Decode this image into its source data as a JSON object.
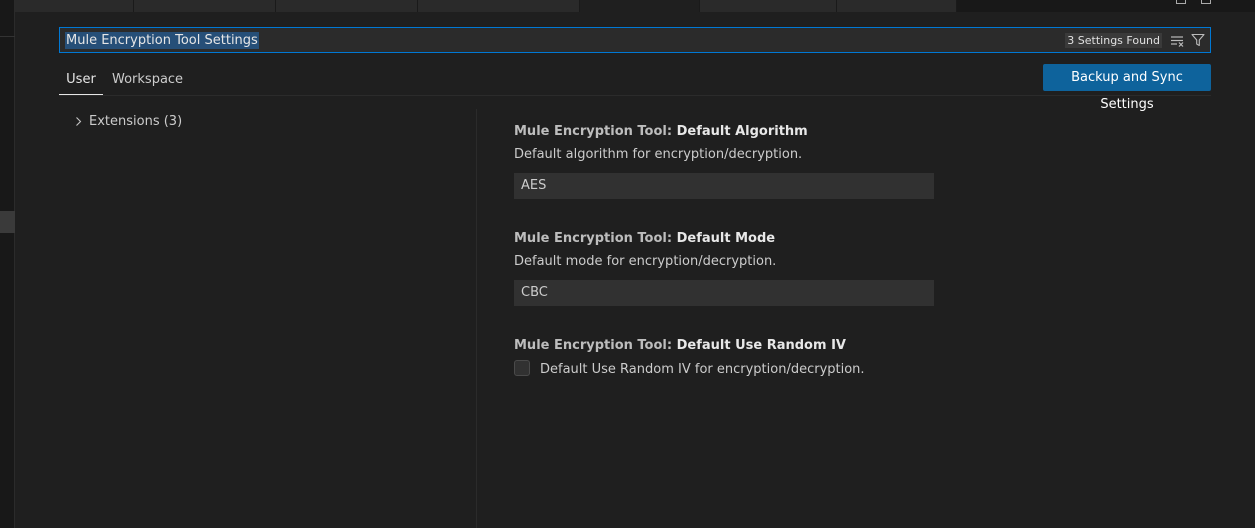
{
  "search": {
    "value": "Mule Encryption Tool Settings",
    "result_count": "3 Settings Found",
    "clear_icon": "clear-filter-icon",
    "filter_icon": "filter-icon"
  },
  "scope_tabs": [
    {
      "label": "User",
      "active": true
    },
    {
      "label": "Workspace",
      "active": false
    }
  ],
  "sync_button": {
    "label": "Backup and Sync Settings"
  },
  "toc": {
    "items": [
      {
        "label": "Extensions (3)",
        "icon": "chevron-right-icon"
      }
    ]
  },
  "settings": [
    {
      "category": "Mule Encryption Tool: ",
      "key": "Default Algorithm",
      "description": "Default algorithm for encryption/decryption.",
      "value": "AES"
    },
    {
      "category": "Mule Encryption Tool: ",
      "key": "Default Mode",
      "description": "Default mode for encryption/decryption.",
      "value": "CBC"
    },
    {
      "category": "Mule Encryption Tool: ",
      "key": "Default Use Random IV",
      "description": "Default Use Random IV for encryption/decryption.",
      "checked": false
    }
  ],
  "colors": {
    "accent": "#0078d4",
    "button_bg": "#0e639c",
    "background": "#1f1f1f"
  }
}
